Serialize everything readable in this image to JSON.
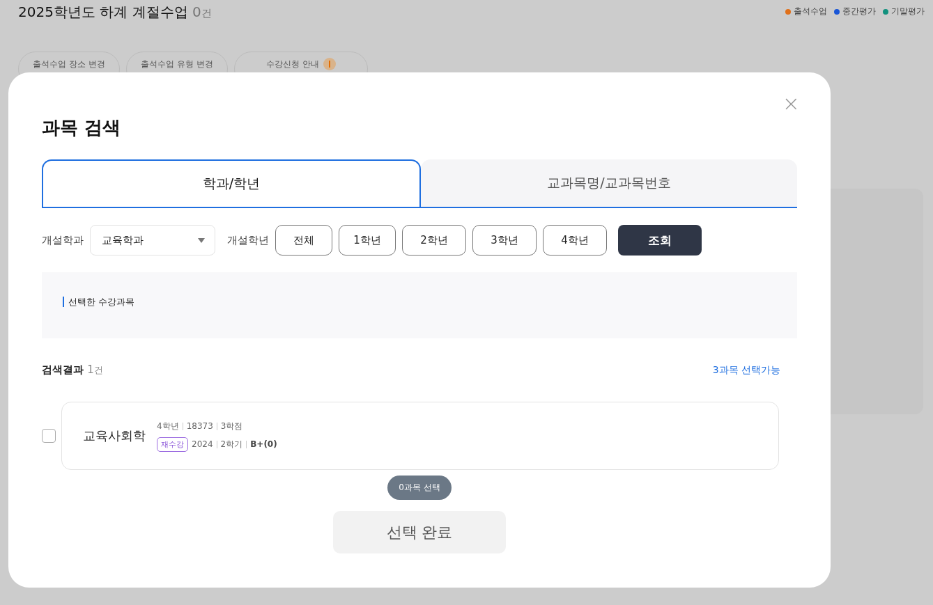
{
  "page": {
    "title": "2025학년도 하계 계절수업",
    "count": "0",
    "count_unit": "건",
    "legend": [
      {
        "label": "출석수업",
        "color": "#e0701a"
      },
      {
        "label": "중간평가",
        "color": "#1a56d6"
      },
      {
        "label": "기말평가",
        "color": "#12917e"
      }
    ],
    "actions": [
      {
        "label": "출석수업 장소 변경",
        "alert": false
      },
      {
        "label": "출석수업 유형 변경",
        "alert": false
      },
      {
        "label": "수강신청 안내",
        "alert": true
      }
    ]
  },
  "modal": {
    "title": "과목 검색",
    "close": "×",
    "tabs": [
      {
        "label": "학과/학년",
        "selected": true
      },
      {
        "label": "교과목명/교과목번호",
        "selected": false
      }
    ],
    "department_label": "개설학과",
    "department_value": "교육학과",
    "grade_label": "개설학년",
    "grades": [
      {
        "label": "전체",
        "selected": false
      },
      {
        "label": "1학년",
        "selected": false
      },
      {
        "label": "2학년",
        "selected": false
      },
      {
        "label": "3학년",
        "selected": false
      },
      {
        "label": "4학년",
        "selected": false
      }
    ],
    "search_button": "조회",
    "selected_section_title": "선택한 수강과목",
    "results_label": "검색결과",
    "results_count": "1",
    "results_unit": "건",
    "limit_note": "3과목 선택가능",
    "results": [
      {
        "name": "교육사회학",
        "checked": false,
        "grade": "4학년",
        "code": "18373",
        "credits": "3학점",
        "tag": "재수강",
        "year": "2024",
        "term": "2학기",
        "score": "B+(0)"
      }
    ],
    "selection_count": "0과목 선택",
    "done_button": "선택 완료"
  }
}
